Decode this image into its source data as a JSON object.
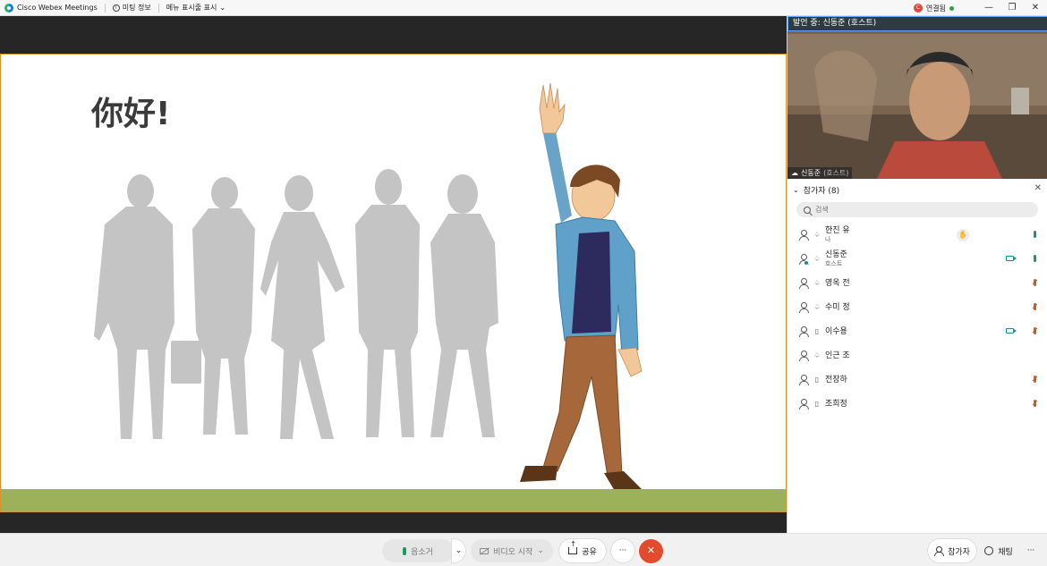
{
  "titlebar": {
    "app_name": "Cisco Webex Meetings",
    "meeting_info": "미팅 정보",
    "menu_toggle": "메뉴 표시줄 표시",
    "connection_label": "연결됨",
    "connection_badge": "C",
    "minimize": "—",
    "restore": "❐",
    "close": "✕"
  },
  "slide": {
    "title": "你好!"
  },
  "video": {
    "speaking_label": "발언 중: 신동준 (호스트)",
    "name": "신동준",
    "role": "(호스트)"
  },
  "participants": {
    "header": "참가자 (8)",
    "search_placeholder": "검색",
    "list": [
      {
        "name": "한진 유",
        "sub": "나",
        "conn": "cloud",
        "raise_hand": true,
        "camera": false,
        "mic": "on",
        "host": false
      },
      {
        "name": "신동준",
        "sub": "호스트",
        "conn": "cloud",
        "raise_hand": false,
        "camera": true,
        "mic": "on",
        "host": true
      },
      {
        "name": "영옥 전",
        "sub": "",
        "conn": "cloud",
        "raise_hand": false,
        "camera": false,
        "mic": "muted",
        "host": false
      },
      {
        "name": "수미 정",
        "sub": "",
        "conn": "cloud",
        "raise_hand": false,
        "camera": false,
        "mic": "muted",
        "host": false
      },
      {
        "name": "이수용",
        "sub": "",
        "conn": "phone",
        "raise_hand": false,
        "camera": true,
        "mic": "muted",
        "host": false
      },
      {
        "name": "인근 조",
        "sub": "",
        "conn": "cloud",
        "raise_hand": false,
        "camera": false,
        "mic": "none",
        "host": false
      },
      {
        "name": "전장하",
        "sub": "",
        "conn": "phone",
        "raise_hand": false,
        "camera": false,
        "mic": "muted",
        "host": false
      },
      {
        "name": "조희정",
        "sub": "",
        "conn": "phone",
        "raise_hand": false,
        "camera": false,
        "mic": "muted",
        "host": false
      }
    ]
  },
  "controls": {
    "mute_label": "음소거",
    "video_label": "비디오 시작",
    "share_label": "공유",
    "more_label": "···",
    "end_label": "✕",
    "participants_label": "참가자",
    "chat_label": "채팅",
    "panel_more_label": "···",
    "dropdown": "⌄"
  },
  "colors": {
    "accent_teal": "#1a8a9a",
    "end_call_red": "#e34b2e",
    "slide_band": "#9bb25a",
    "speaking_border": "#5ba7ff"
  }
}
